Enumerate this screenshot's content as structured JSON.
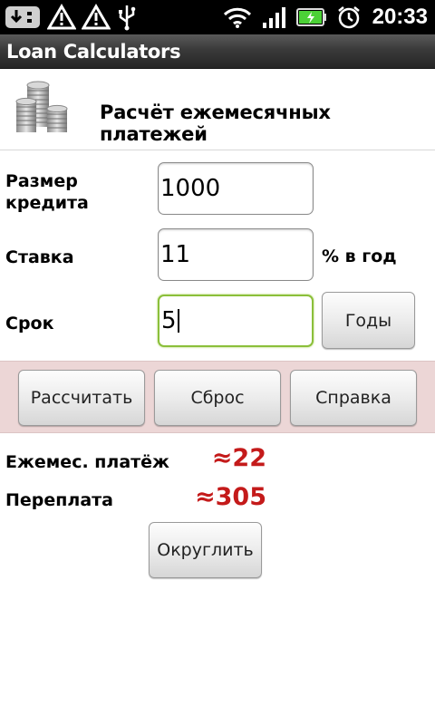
{
  "status_bar": {
    "time": "20:33",
    "icons": [
      "download-icon",
      "warning-icon",
      "warning-icon",
      "usb-icon",
      "wifi-icon",
      "signal-icon",
      "battery-charging-icon",
      "alarm-icon"
    ],
    "battery_color": "#4cd137"
  },
  "app": {
    "title": "Loan Calculators"
  },
  "header": {
    "title": "Расчёт ежемесячных платежей",
    "icon": "coins-icon"
  },
  "form": {
    "amount": {
      "label_line1": "Размер",
      "label_line2": "кредита",
      "value": "1000"
    },
    "rate": {
      "label": "Ставка",
      "value": "11",
      "unit": "% в год"
    },
    "term": {
      "label": "Срок",
      "value": "5",
      "unit_button": "Годы"
    }
  },
  "actions": {
    "calculate": "Рассчитать",
    "reset": "Сброс",
    "help": "Справка"
  },
  "results": {
    "monthly_label": "Ежемес. платёж",
    "monthly_value": "≈22",
    "overpayment_label": "Переплата",
    "overpayment_value": "≈305",
    "round_button": "Округлить"
  },
  "colors": {
    "accent_result": "#c41a1a",
    "button_band": "#ecd6d6",
    "focus_border": "#8bbf3a"
  }
}
